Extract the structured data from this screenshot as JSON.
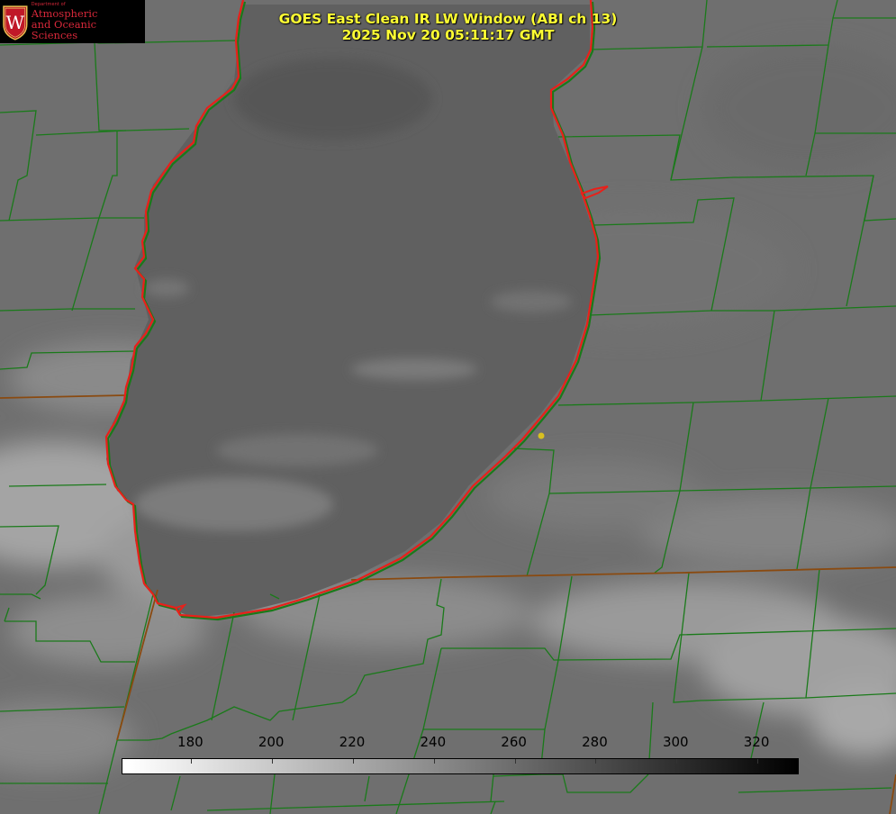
{
  "logo": {
    "department": "Department of",
    "line1": "Atmospheric",
    "line2": "and Oceanic Sciences",
    "seal_letter": "W",
    "color": "#d8283a"
  },
  "title": {
    "line1": "GOES East Clean IR LW Window (ABI ch 13)",
    "line2": "2025 Nov 20 05:11:17 GMT",
    "color": "#ffff33"
  },
  "colorbar": {
    "ticks": [
      "180",
      "200",
      "220",
      "240",
      "260",
      "280",
      "300",
      "320"
    ],
    "min": 163,
    "max": 330,
    "tick_values": [
      180,
      200,
      220,
      240,
      260,
      280,
      300,
      320
    ]
  },
  "map": {
    "coastline_color": "#e8201a",
    "boundary_color": "#1a7a1a",
    "state_line_color": "#8a4a10",
    "marker_color": "#d8c020",
    "lake": "Lake Michigan"
  }
}
